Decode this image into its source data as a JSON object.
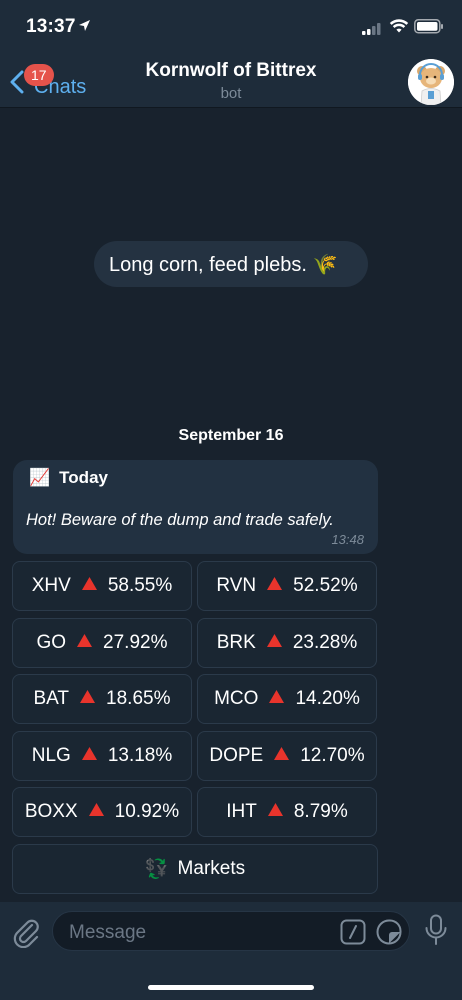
{
  "status_bar": {
    "time": "13:37"
  },
  "header": {
    "back_badge": "17",
    "back_label": "Chats",
    "title": "Kornwolf of Bittrex",
    "subtitle": "bot"
  },
  "service_message": "Long corn, feed plebs. 🌾",
  "date_divider": "September 16",
  "message": {
    "emoji": "📈",
    "title": "Today",
    "body": "Hot! Beware of the dump and trade safely.",
    "time": "13:48"
  },
  "keyboard": {
    "rows": [
      [
        {
          "ticker": "XHV",
          "change": "58.55%"
        },
        {
          "ticker": "RVN",
          "change": "52.52%"
        }
      ],
      [
        {
          "ticker": "GO",
          "change": "27.92%"
        },
        {
          "ticker": "BRK",
          "change": "23.28%"
        }
      ],
      [
        {
          "ticker": "BAT",
          "change": "18.65%"
        },
        {
          "ticker": "MCO",
          "change": "14.20%"
        }
      ],
      [
        {
          "ticker": "NLG",
          "change": "13.18%"
        },
        {
          "ticker": "DOPE",
          "change": "12.70%"
        }
      ],
      [
        {
          "ticker": "BOXX",
          "change": "10.92%"
        },
        {
          "ticker": "IHT",
          "change": "8.79%"
        }
      ]
    ],
    "markets_icon": "💱",
    "markets_label": "Markets"
  },
  "input": {
    "placeholder": "Message"
  },
  "colors": {
    "background": "#18222d",
    "bar": "#1e2c3a",
    "accent": "#5eb0ef",
    "badge": "#e5534b",
    "up_arrow": "#e8342c"
  }
}
